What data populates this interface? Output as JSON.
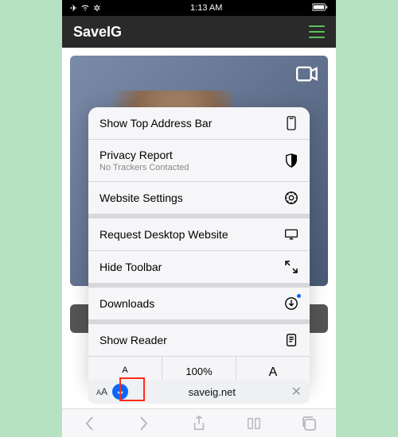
{
  "status": {
    "time": "1:13 AM"
  },
  "header": {
    "brand": "SaveIG"
  },
  "menu": {
    "topbar": "Show Top Address Bar",
    "privacy": "Privacy Report",
    "privacy_sub": "No Trackers Contacted",
    "settings": "Website Settings",
    "desktop": "Request Desktop Website",
    "hide": "Hide Toolbar",
    "downloads": "Downloads",
    "reader": "Show Reader",
    "zoom_small": "A",
    "zoom_pct": "100%",
    "zoom_big": "A"
  },
  "addr": {
    "aa_small": "A",
    "aa_big": "A",
    "url": "saveig.net"
  }
}
